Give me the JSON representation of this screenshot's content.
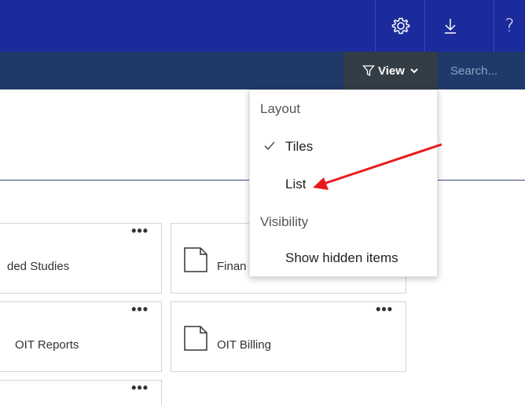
{
  "topbar": {
    "settings_icon": "gear-icon",
    "download_icon": "download-arrow-icon",
    "help_label": "?"
  },
  "commandbar": {
    "view_label": "View",
    "view_icons": [
      "filter-icon",
      "chevron-down-icon"
    ],
    "search_placeholder": "Search..."
  },
  "tiles": [
    {
      "name": "ded Studies",
      "icon": "none"
    },
    {
      "name": "Finan",
      "icon": "file-icon"
    },
    {
      "name": "OIT Reports",
      "icon": "none"
    },
    {
      "name": "OIT Billing",
      "icon": "file-icon"
    }
  ],
  "more_label": "•••",
  "dropdown": {
    "layout_header": "Layout",
    "tiles_label": "Tiles",
    "tiles_checked": true,
    "list_label": "List",
    "visibility_header": "Visibility",
    "hidden_label": "Show hidden items"
  },
  "annotation": {
    "color": "#e8191c"
  },
  "colors": {
    "topbar": "#1c2b9c",
    "commandbar": "#1f3a68",
    "view_button": "#333d46"
  }
}
